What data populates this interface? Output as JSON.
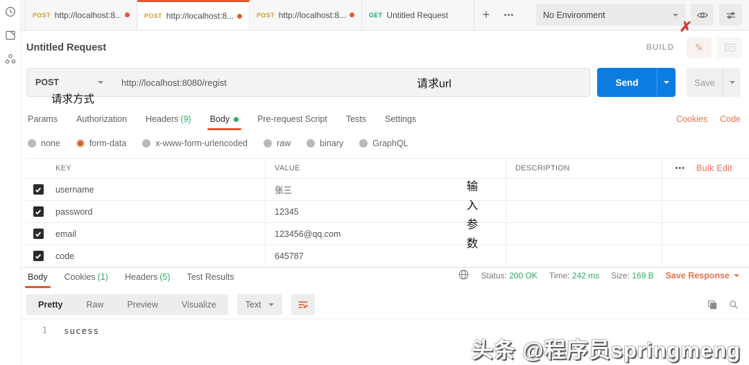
{
  "tabbar": {
    "tabs": [
      {
        "method": "POST",
        "title": "http://localhost:8..."
      },
      {
        "method": "POST",
        "title": "http://localhost:8..."
      },
      {
        "method": "POST",
        "title": "http://localhost:8..."
      },
      {
        "method": "GET",
        "title": "Untitled Request"
      }
    ],
    "add_tab_label": "+",
    "more_label": "•••",
    "environment": "No Environment"
  },
  "header": {
    "title": "Untitled Request",
    "mode_label": "BUILD"
  },
  "url_bar": {
    "method": "POST",
    "url": "http://localhost:8080/regist",
    "send_label": "Send",
    "save_label": "Save"
  },
  "annotations": {
    "method_label": "请求方式",
    "url_label": "请求url",
    "params_label": "输入参数",
    "mark": "✗"
  },
  "request_tabs": {
    "params": "Params",
    "authorization": "Authorization",
    "headers": "Headers",
    "headers_count": "(9)",
    "body": "Body",
    "prerequest": "Pre-request Script",
    "tests": "Tests",
    "settings": "Settings",
    "cookies_link": "Cookies",
    "code_link": "Code"
  },
  "body_modes": {
    "none": "none",
    "form_data": "form-data",
    "urlencoded": "x-www-form-urlencoded",
    "raw": "raw",
    "binary": "binary",
    "graphql": "GraphQL"
  },
  "params_table": {
    "col_key": "KEY",
    "col_value": "VALUE",
    "col_description": "DESCRIPTION",
    "more_label": "•••",
    "bulk_edit_label": "Bulk Edit",
    "rows": [
      {
        "key": "username",
        "value": "张三"
      },
      {
        "key": "password",
        "value": "12345"
      },
      {
        "key": "email",
        "value": "123456@qq.com"
      },
      {
        "key": "code",
        "value": "645787"
      }
    ]
  },
  "response": {
    "tab_body": "Body",
    "tab_cookies": "Cookies",
    "cookies_count": "(1)",
    "tab_headers": "Headers",
    "headers_count": "(5)",
    "tab_test_results": "Test Results",
    "status_label": "Status:",
    "status_value": "200 OK",
    "time_label": "Time:",
    "time_value": "242 ms",
    "size_label": "Size:",
    "size_value": "169 B",
    "save_response_label": "Save Response",
    "view_pretty": "Pretty",
    "view_raw": "Raw",
    "view_preview": "Preview",
    "view_visualize": "Visualize",
    "format_label": "Text",
    "line_number": "1",
    "body_text": "sucess"
  },
  "watermark": "头条 @程序员springmeng",
  "colors": {
    "accent_orange": "#e4582c",
    "link_orange": "#e8734d",
    "green": "#27ae60",
    "send_blue": "#0b7ce0",
    "post_amber": "#d79a33",
    "get_green": "#26a269"
  }
}
